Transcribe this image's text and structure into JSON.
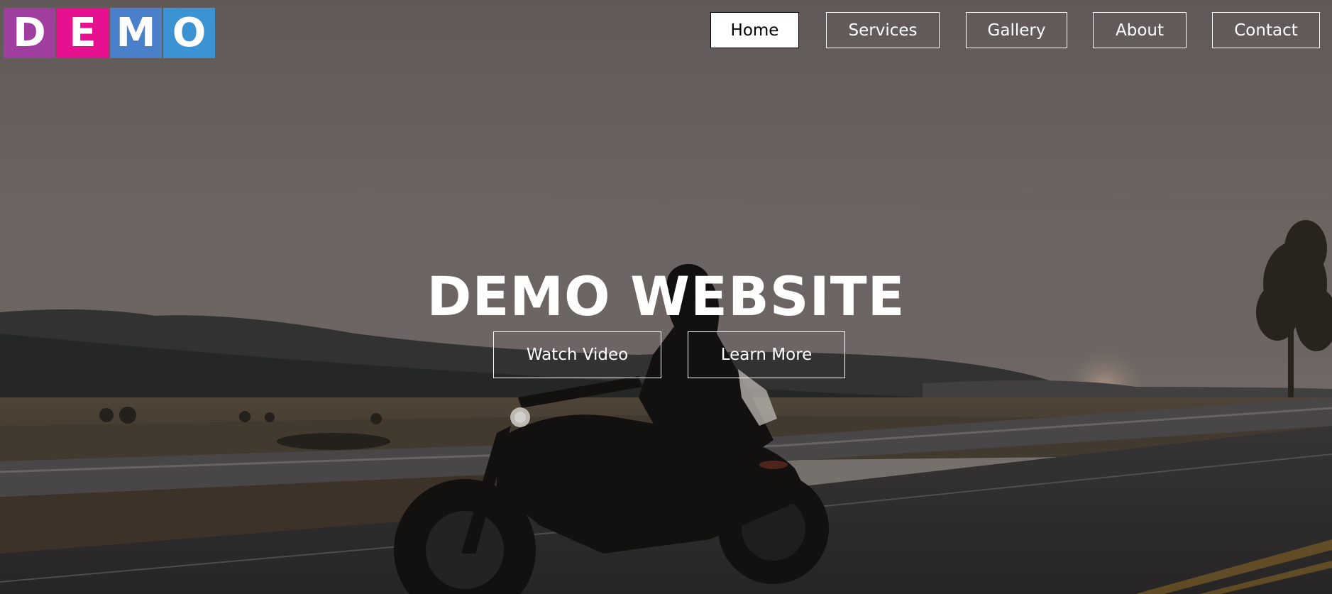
{
  "logo": {
    "letters": [
      "D",
      "E",
      "M",
      "O"
    ],
    "colors": [
      "#a03e9f",
      "#e5118f",
      "#4a7fc9",
      "#3b93d4"
    ]
  },
  "nav": {
    "items": [
      {
        "label": "Home",
        "active": true
      },
      {
        "label": "Services",
        "active": false
      },
      {
        "label": "Gallery",
        "active": false
      },
      {
        "label": "About",
        "active": false
      },
      {
        "label": "Contact",
        "active": false
      }
    ]
  },
  "hero": {
    "title": "DEMO WEBSITE",
    "watch_video_label": "Watch Video",
    "learn_more_label": "Learn More",
    "image_name": "motorcycle-rider-on-highway-at-sunset"
  },
  "colors": {
    "text": "#ffffff",
    "active_nav_bg": "#ffffff",
    "active_nav_text": "#000000"
  }
}
